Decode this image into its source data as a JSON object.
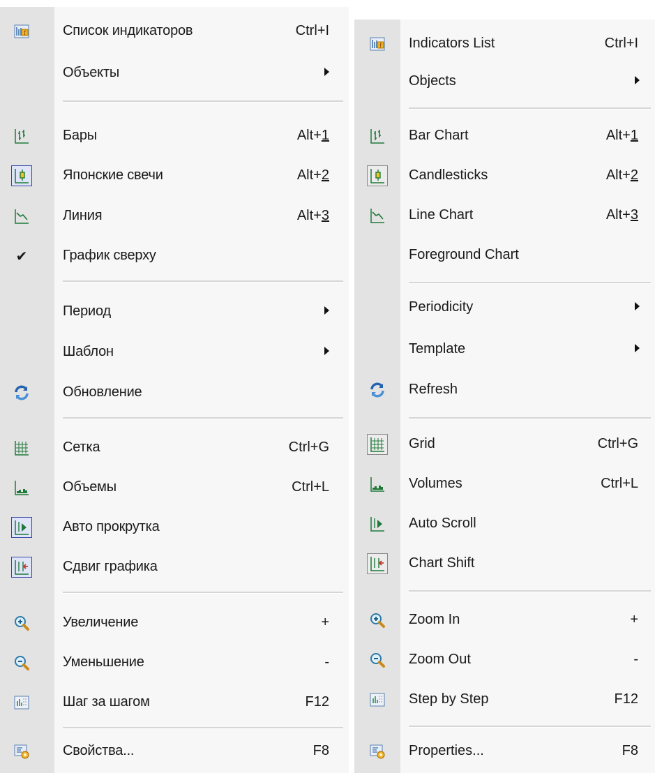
{
  "menus": {
    "ru": {
      "indicators": {
        "label": "Список индикаторов",
        "shortcut": "Ctrl+I"
      },
      "objects": {
        "label": "Объекты"
      },
      "bars": {
        "label": "Бары",
        "shortcut_prefix": "Alt+",
        "shortcut_key": "1"
      },
      "candles": {
        "label": "Японские свечи",
        "shortcut_prefix": "Alt+",
        "shortcut_key": "2"
      },
      "line": {
        "label": "Линия",
        "shortcut_prefix": "Alt+",
        "shortcut_key": "3"
      },
      "foreground": {
        "label": "График сверху",
        "check": "✔"
      },
      "period": {
        "label": "Период"
      },
      "template": {
        "label": "Шаблон"
      },
      "refresh": {
        "label": "Обновление"
      },
      "grid": {
        "label": "Сетка",
        "shortcut": "Ctrl+G"
      },
      "volumes": {
        "label": "Объемы",
        "shortcut": "Ctrl+L"
      },
      "autoscroll": {
        "label": "Авто прокрутка"
      },
      "shift": {
        "label": "Сдвиг графика"
      },
      "zoomin": {
        "label": "Увеличение",
        "shortcut": "+"
      },
      "zoomout": {
        "label": "Уменьшение",
        "shortcut": "-"
      },
      "step": {
        "label": "Шаг за шагом",
        "shortcut": "F12"
      },
      "properties": {
        "label": "Свойства...",
        "shortcut": "F8"
      }
    },
    "en": {
      "indicators": {
        "label": "Indicators List",
        "shortcut": "Ctrl+I"
      },
      "objects": {
        "label": "Objects"
      },
      "bars": {
        "label": "Bar Chart",
        "shortcut_prefix": "Alt+",
        "shortcut_key": "1"
      },
      "candles": {
        "label": "Candlesticks",
        "shortcut_prefix": "Alt+",
        "shortcut_key": "2"
      },
      "line": {
        "label": "Line Chart",
        "shortcut_prefix": "Alt+",
        "shortcut_key": "3"
      },
      "foreground": {
        "label": "Foreground Chart"
      },
      "period": {
        "label": "Periodicity"
      },
      "template": {
        "label": "Template"
      },
      "refresh": {
        "label": "Refresh"
      },
      "grid": {
        "label": "Grid",
        "shortcut": "Ctrl+G"
      },
      "volumes": {
        "label": "Volumes",
        "shortcut": "Ctrl+L"
      },
      "autoscroll": {
        "label": "Auto Scroll"
      },
      "shift": {
        "label": "Chart Shift"
      },
      "zoomin": {
        "label": "Zoom In",
        "shortcut": "+"
      },
      "zoomout": {
        "label": "Zoom Out",
        "shortcut": "-"
      },
      "step": {
        "label": "Step by Step",
        "shortcut": "F12"
      },
      "properties": {
        "label": "Properties...",
        "shortcut": "F8"
      }
    }
  },
  "icons": {
    "indicators": "indicators-list-icon",
    "bars": "bar-chart-icon",
    "candles": "candlesticks-icon",
    "line": "line-chart-icon",
    "refresh": "refresh-icon",
    "grid": "grid-icon",
    "volumes": "volumes-icon",
    "autoscroll": "auto-scroll-icon",
    "shift": "chart-shift-icon",
    "zoomin": "zoom-in-icon",
    "zoomout": "zoom-out-icon",
    "step": "step-by-step-icon",
    "properties": "properties-icon"
  },
  "colors": {
    "gutter": "#e3e3e3",
    "menu_bg": "#f7f7f7",
    "checked_border": "#3a46a8",
    "icon_green": "#1f7a3a",
    "icon_blue": "#2563b0"
  }
}
